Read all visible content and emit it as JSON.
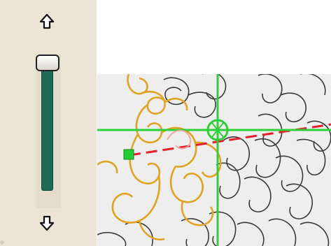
{
  "zoom_panel": {
    "up_icon": "arrow-up-icon",
    "down_icon": "arrow-down-icon",
    "slider_level": 1.0
  },
  "quilt_canvas": {
    "background_color": "#eeeeee",
    "crosshair_color": "#2fcf3a",
    "guide_line_color": "#e8202c",
    "active_pattern_color": "#e0a422",
    "inactive_pattern_color": "#333333",
    "start_marker_color": "#22cc33"
  },
  "colors": {
    "panel_bg": "#ece4d5",
    "slider_track": "#1f6a57"
  }
}
